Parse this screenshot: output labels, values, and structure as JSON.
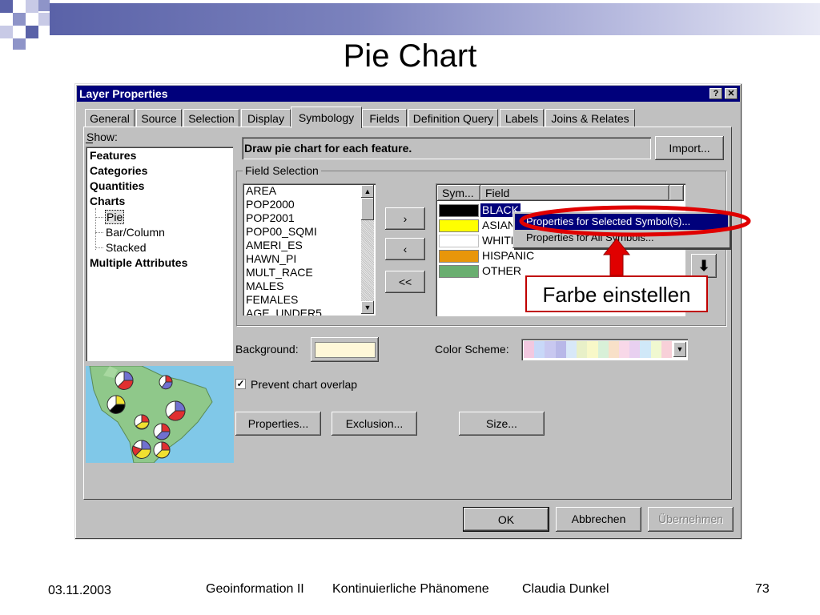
{
  "slide": {
    "title": "Pie Chart",
    "footer_date": "03.11.2003",
    "footer_course": "Geoinformation II",
    "footer_topic": "Kontinuierliche Phänomene",
    "footer_author": "Claudia Dunkel",
    "page_number": "73",
    "callout": "Farbe einstellen"
  },
  "window": {
    "title": "Layer Properties",
    "help_button": "?",
    "close_button": "✕",
    "tabs": [
      "General",
      "Source",
      "Selection",
      "Display",
      "Symbology",
      "Fields",
      "Definition Query",
      "Labels",
      "Joins & Relates"
    ],
    "active_tab": "Symbology"
  },
  "show": {
    "label": "Show:",
    "items": [
      "Features",
      "Categories",
      "Quantities",
      "Charts",
      "Pie",
      "Bar/Column",
      "Stacked",
      "Multiple Attributes"
    ],
    "selected": "Pie"
  },
  "symbology": {
    "description": "Draw pie chart for each feature.",
    "import_label": "Import...",
    "field_selection_label": "Field Selection",
    "available_fields": [
      "AREA",
      "POP2000",
      "POP2001",
      "POP00_SQMI",
      "AMERI_ES",
      "HAWN_PI",
      "MULT_RACE",
      "MALES",
      "FEMALES",
      "AGE_UNDER5"
    ],
    "add_button": "›",
    "remove_button": "‹",
    "remove_all_button": "<<",
    "table_headers": [
      "Sym...",
      "Field"
    ],
    "selected_fields": [
      {
        "color": "#000000",
        "name": "BLACK"
      },
      {
        "color": "#ffff00",
        "name": "ASIAN"
      },
      {
        "color": "#ffffff",
        "name": "WHITE"
      },
      {
        "color": "#e8960a",
        "name": "HISPANIC"
      },
      {
        "color": "#6aae70",
        "name": "OTHER"
      }
    ],
    "move_down_icon": "arrow-down-icon",
    "context_menu": [
      "Properties for Selected Symbol(s)...",
      "Properties for All Symbols..."
    ],
    "background_label": "Background:",
    "background_color": "#fff8d8",
    "color_scheme_label": "Color Scheme:",
    "color_scheme_colors": [
      "#f2c8e0",
      "#c8d8f8",
      "#c8c8f0",
      "#b8b8e8",
      "#d8e8f8",
      "#e8f0c8",
      "#f8f8c8",
      "#d8f0d8",
      "#f8e0c8",
      "#f8d8e8",
      "#e8d0f0",
      "#d0e8f8",
      "#f0f8d0",
      "#f8d0d8"
    ],
    "prevent_overlap_label": "Prevent chart overlap",
    "prevent_overlap_checked": true,
    "properties_button": "Properties...",
    "exclusion_button": "Exclusion...",
    "size_button": "Size..."
  },
  "footer_buttons": {
    "ok": "OK",
    "cancel": "Abbrechen",
    "apply": "Übernehmen"
  }
}
